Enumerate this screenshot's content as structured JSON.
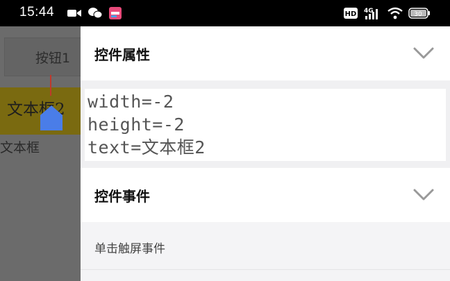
{
  "status_bar": {
    "time": "15:44",
    "left_icons": [
      "video-icon",
      "wechat-icon",
      "app-notification-icon"
    ],
    "right_icons": [
      "hd-icon",
      "4g-signal-icon",
      "wifi-icon",
      "battery-icon"
    ],
    "hd_label": "HD",
    "network_label": "4G",
    "battery_level": "30"
  },
  "background_app": {
    "button1_label": "按钮1",
    "textbox2_label": "文本框2",
    "textbox3_label": "文本框"
  },
  "panel": {
    "properties_title": "控件属性",
    "properties": [
      "width=-2",
      "height=-2",
      "text=文本框2"
    ],
    "events_title": "控件事件",
    "events": [
      "单击触屏事件"
    ]
  }
}
